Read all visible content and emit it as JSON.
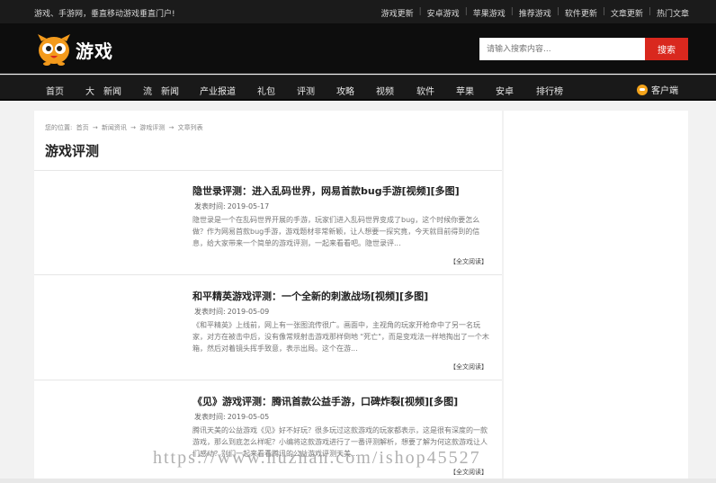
{
  "topbar": {
    "slogan": "游戏、手游网，垂直移动游戏垂直门户!",
    "links": [
      "游戏更新",
      "安卓游戏",
      "苹果游戏",
      "推荐游戏",
      "软件更新",
      "文章更新",
      "热门文章"
    ]
  },
  "header": {
    "logo_text": "游戏",
    "search_placeholder": "请输入搜索内容...",
    "search_button": "搜索"
  },
  "nav": {
    "items": [
      "首页",
      "大　新闻",
      "流　新闻",
      "产业报道",
      "礼包",
      "评测",
      "攻略",
      "视频",
      "软件",
      "苹果",
      "安卓",
      "排行榜"
    ],
    "client": "客户端"
  },
  "breadcrumb": {
    "prefix": "您的位置:",
    "items": [
      "首页",
      "→",
      "新闻资讯",
      "→",
      "游戏评测",
      "→",
      "文章列表"
    ]
  },
  "page_title": "游戏评测",
  "articles": [
    {
      "title": "隐世录评测：进入乱码世界，网易首款bug手游[视频][多图]",
      "date_label": "发表时间:",
      "date": "2019-05-17",
      "summary": "隐世录是一个在乱码世界开展的手游，玩家们进入乱码世界变成了bug，这个时候你要怎么做？作为网易首款bug手游，游戏题材非常新颖，让人想要一探究竟，今天就目前得到的信息，给大家带来一个简单的游戏评测，一起来看看吧。隐世录评...",
      "more": "【全文阅读】"
    },
    {
      "title": "和平精英游戏评测：一个全新的刺激战场[视频][多图]",
      "date_label": "发表时间:",
      "date": "2019-05-09",
      "summary": "《和平精英》上线前，网上有一张图流传很广。画面中，主视角的玩家开枪命中了另一名玩家，对方在被击中后，没有像常规射击游戏那样倒地 \"死亡\"，而是变戏法一样地掏出了一个木箱，然后对着镜头挥手致意，表示出局。这个在游...",
      "more": "【全文阅读】"
    },
    {
      "title": "《见》游戏评测：腾讯首款公益手游，口碑炸裂[视频][多图]",
      "date_label": "发表时间:",
      "date": "2019-05-05",
      "summary": "腾讯天美的公益游戏《见》好不好玩？很多玩过这款游戏的玩家都表示，这是很有深度的一款游戏，那么到底怎么样呢？小编将这款游戏进行了一番评测解析，想要了解为何这款游戏让人们感动？别们一起来看看腾讯的公益游戏评测天美...",
      "more": "【全文阅读】"
    }
  ],
  "watermark": "https://www.huzhan.com/ishop45527"
}
